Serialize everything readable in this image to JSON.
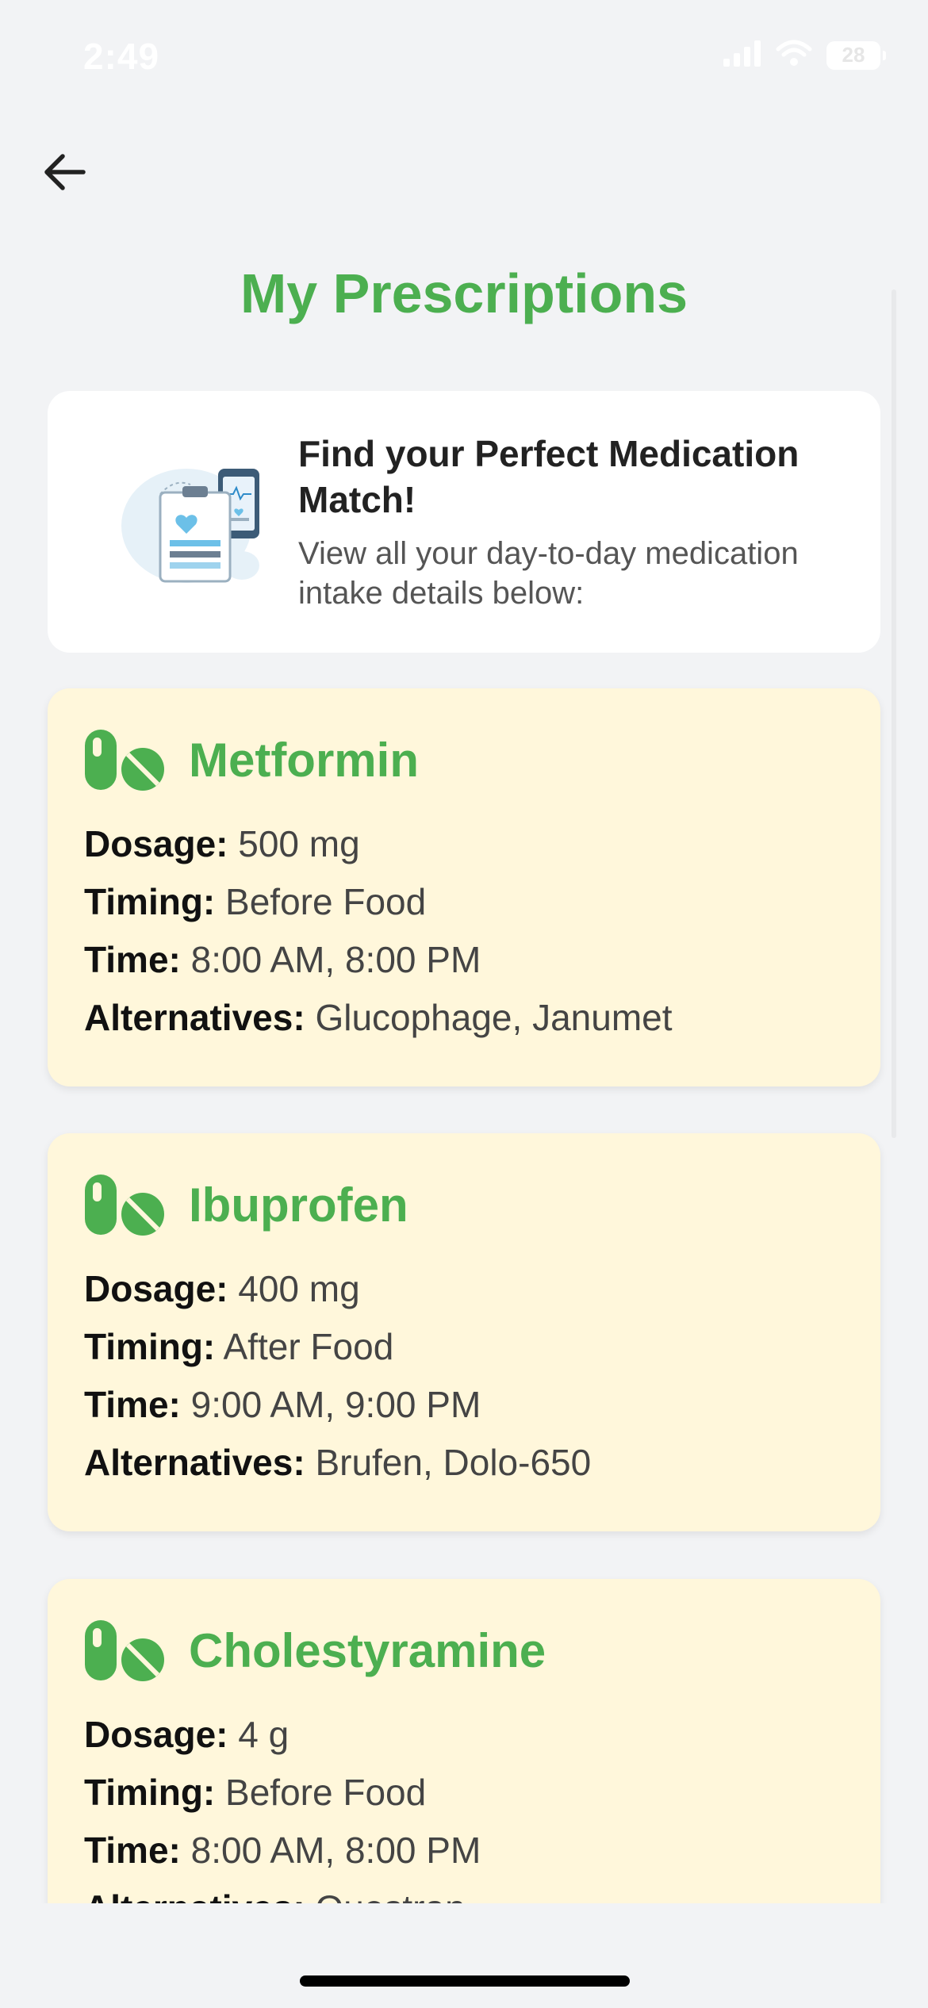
{
  "status_bar": {
    "time": "2:49",
    "battery": "28"
  },
  "header": {
    "back_icon": "arrow-left-icon",
    "title": "My Prescriptions"
  },
  "info_card": {
    "illustration_icon": "medical-records-phone-icon",
    "heading": "Find your Perfect Medication Match!",
    "subtitle": "View all your day-to-day medication intake details below:"
  },
  "labels": {
    "dosage": "Dosage:",
    "timing": "Timing:",
    "time": "Time:",
    "alternatives": "Alternatives:"
  },
  "prescriptions": [
    {
      "icon": "pills-icon",
      "name": "Metformin",
      "dosage": "500 mg",
      "timing": "Before Food",
      "time": "8:00 AM, 8:00 PM",
      "alternatives": "Glucophage, Janumet"
    },
    {
      "icon": "pills-icon",
      "name": "Ibuprofen",
      "dosage": "400 mg",
      "timing": "After Food",
      "time": "9:00 AM, 9:00 PM",
      "alternatives": "Brufen, Dolo-650"
    },
    {
      "icon": "pills-icon",
      "name": "Cholestyramine",
      "dosage": "4 g",
      "timing": "Before Food",
      "time": "8:00 AM, 8:00 PM",
      "alternatives": "Questran"
    }
  ],
  "colors": {
    "accent_green": "#4caf50",
    "card_background": "#fff7db",
    "page_background": "#f2f3f5"
  }
}
